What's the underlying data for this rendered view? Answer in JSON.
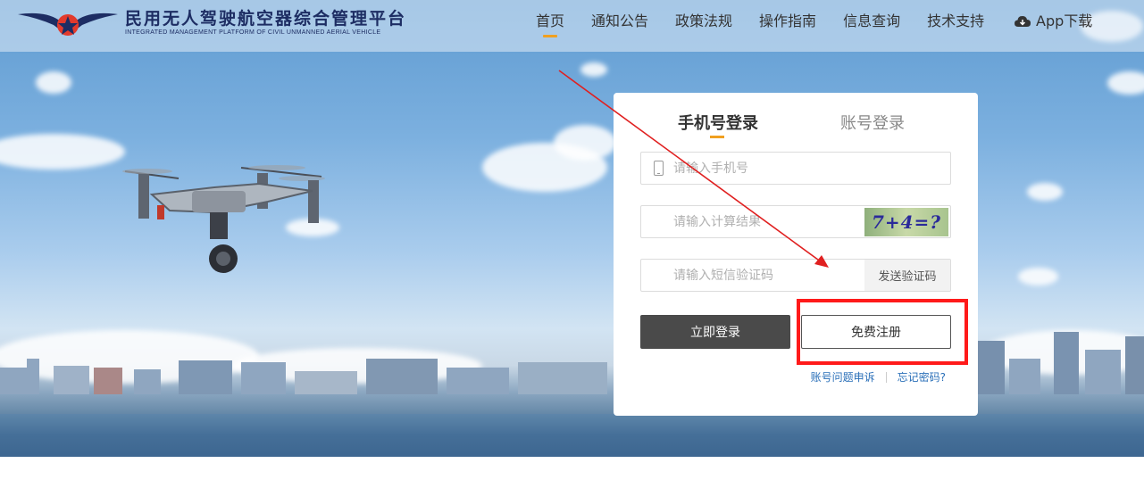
{
  "header": {
    "logo_title": "民用无人驾驶航空器综合管理平台",
    "logo_subtitle": "INTEGRATED MANAGEMENT PLATFORM OF CIVIL UNMANNED AERIAL VEHICLE",
    "nav": [
      {
        "label": "首页",
        "active": true
      },
      {
        "label": "通知公告"
      },
      {
        "label": "政策法规"
      },
      {
        "label": "操作指南"
      },
      {
        "label": "信息查询"
      },
      {
        "label": "技术支持"
      }
    ],
    "app_download": "App下载",
    "app_icon": "cloud-download-icon"
  },
  "login": {
    "tabs": [
      {
        "label": "手机号登录",
        "active": true
      },
      {
        "label": "账号登录"
      }
    ],
    "phone_placeholder": "请输入手机号",
    "calc_placeholder": "请输入计算结果",
    "captcha_text": "7+4=?",
    "sms_placeholder": "请输入短信验证码",
    "send_code_label": "发送验证码",
    "login_button": "立即登录",
    "register_button": "免费注册",
    "appeal_link": "账号问题申诉",
    "forgot_link": "忘记密码?"
  },
  "annotation": {
    "box_color": "#ff1a1a",
    "arrow_color": "#e02020"
  },
  "colors": {
    "accent": "#f0a020",
    "link": "#2a6fb8",
    "login_button_bg": "#4a4a4a"
  }
}
